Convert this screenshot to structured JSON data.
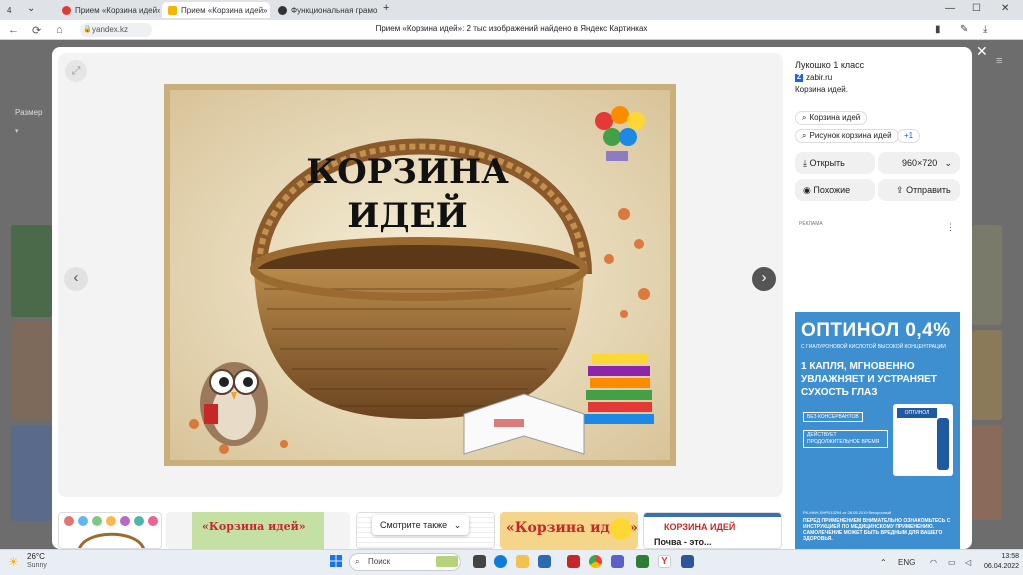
{
  "tabs": [
    {
      "label": "4",
      "active": false
    },
    {
      "label": "Прием «Корзина идей» ...",
      "active": false
    },
    {
      "label": "Прием «Корзина идей»",
      "active": true
    },
    {
      "label": "Функциональная грамот",
      "active": false
    }
  ],
  "new_tab": "+",
  "window_controls": {
    "minimize": "—",
    "maximize": "☐",
    "close": "✕"
  },
  "address": {
    "url": "yandex.kz",
    "page_title": "Прием «Корзина идей»: 2 тыс изображений найдено в Яндекс Картинках"
  },
  "background": {
    "filter_label": "Размер"
  },
  "viewer": {
    "image_title_line1": "КОРЗИНА",
    "image_title_line2": "ИДЕЙ",
    "prev_arrow": "‹",
    "next_arrow": "›",
    "close": "✕"
  },
  "source": {
    "name": "Лукошко 1 класс",
    "domain": "zabir.ru",
    "text": "Корзина идей."
  },
  "related": {
    "query1": "Корзина идей",
    "query2": "Рисунок корзина идей",
    "more": "+1"
  },
  "actions": {
    "open": "Открыть",
    "size": "960×720",
    "similar": "Похожие",
    "send": "Отправить"
  },
  "ad": {
    "label": "РЕКЛАМА",
    "title": "ОПТИНОЛ 0,4%",
    "subtitle": "С ГИАЛУРОНОВОЙ КИСЛОТОЙ ВЫСОКОЙ КОНЦЕНТРАЦИИ",
    "main": "1 КАПЛЯ, МГНОВЕННО УВЛАЖНЯЕТ И УСТРАНЯЕТ СУХОСТЬ ГЛАЗ",
    "badge1": "БЕЗ КОНСЕРВАНТОВ",
    "badge2": "ДЕЙСТВУЕТ ПРОДОЛЖИТЕЛЬНОЕ ВРЕМЯ",
    "fine": "РК-МНН-SHP013294 от 28.05.2019 бессрочный",
    "footer": "ПЕРЕД ПРИМЕНЕНИЕМ ВНИМАТЕЛЬНО ОЗНАКОМЬТЕСЬ С ИНСТРУКЦИЕЙ ПО МЕДИЦИНСКОМУ ПРИМЕНЕНИЮ. САМОЛЕЧЕНИЕ МОЖЕТ БЫТЬ ВРЕДНЫМ ДЛЯ ВАШЕГО ЗДОРОВЬЯ.",
    "bottle_label": "ОПТИНОЛ"
  },
  "thumbs": {
    "t2_title": "«Корзина идей»",
    "more_similar": "Смотрите также",
    "t4_title": "«Корзина идей»",
    "t5_title": "КОРЗИНА ИДЕЙ",
    "t5_sub": "Почва - это..."
  },
  "taskbar": {
    "temp": "26°C",
    "weather": "Sunny",
    "search": "Поиск",
    "lang": "ENG",
    "time": "13:58",
    "date": "06.04.2022"
  }
}
